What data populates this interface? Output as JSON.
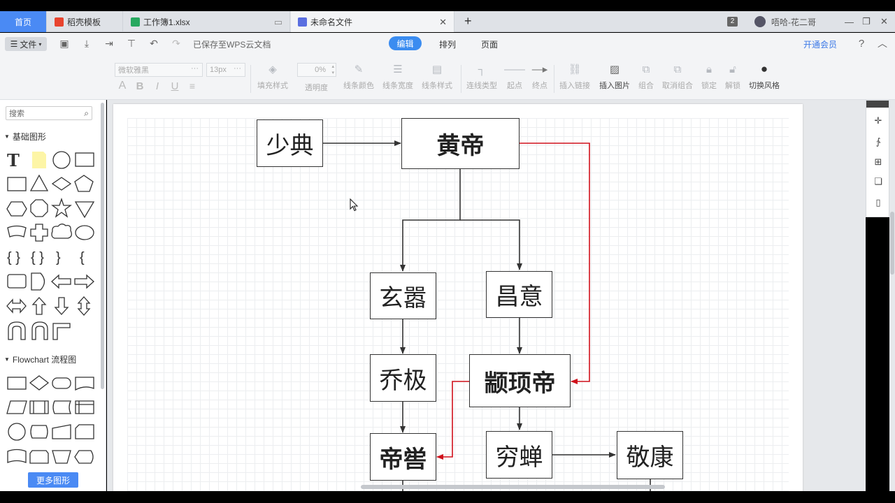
{
  "tabs": {
    "home": "首页",
    "templates": "稻壳模板",
    "excel": "工作簿1.xlsx",
    "active": "未命名文件",
    "window_count": "2",
    "user": "唔哈-花二哥"
  },
  "toolbar": {
    "file_menu": "文件",
    "saved_status": "已保存至WPS云文档",
    "modes": [
      "编辑",
      "排列",
      "页面"
    ],
    "member": "开通会员",
    "help": "?"
  },
  "format": {
    "font_placeholder": "微软雅黑",
    "font_size": "13px",
    "opacity_value": "0%",
    "text_styles": [
      "A",
      "B",
      "I",
      "U"
    ],
    "tools": [
      "填充样式",
      "透明度",
      "线条颜色",
      "线条宽度",
      "线条样式",
      "连线类型",
      "起点",
      "终点",
      "插入链接",
      "插入图片",
      "组合",
      "取消组合",
      "锁定",
      "解锁",
      "切换风格"
    ]
  },
  "panel": {
    "search_placeholder": "搜索",
    "section_basic": "基础图形",
    "section_flow": "Flowchart 流程图",
    "more_button": "更多图形"
  },
  "diagram": {
    "nodes": {
      "shaodian": "少典",
      "huangdi": "黄帝",
      "xuanxiao": "玄嚣",
      "changyi": "昌意",
      "qiaoji": "乔极",
      "zhuanxu": "颛顼帝",
      "diku": "帝喾",
      "qiongchan": "穷蝉",
      "jingkang": "敬康"
    },
    "highlight_color": "#d0101c",
    "line_color": "#333333"
  }
}
